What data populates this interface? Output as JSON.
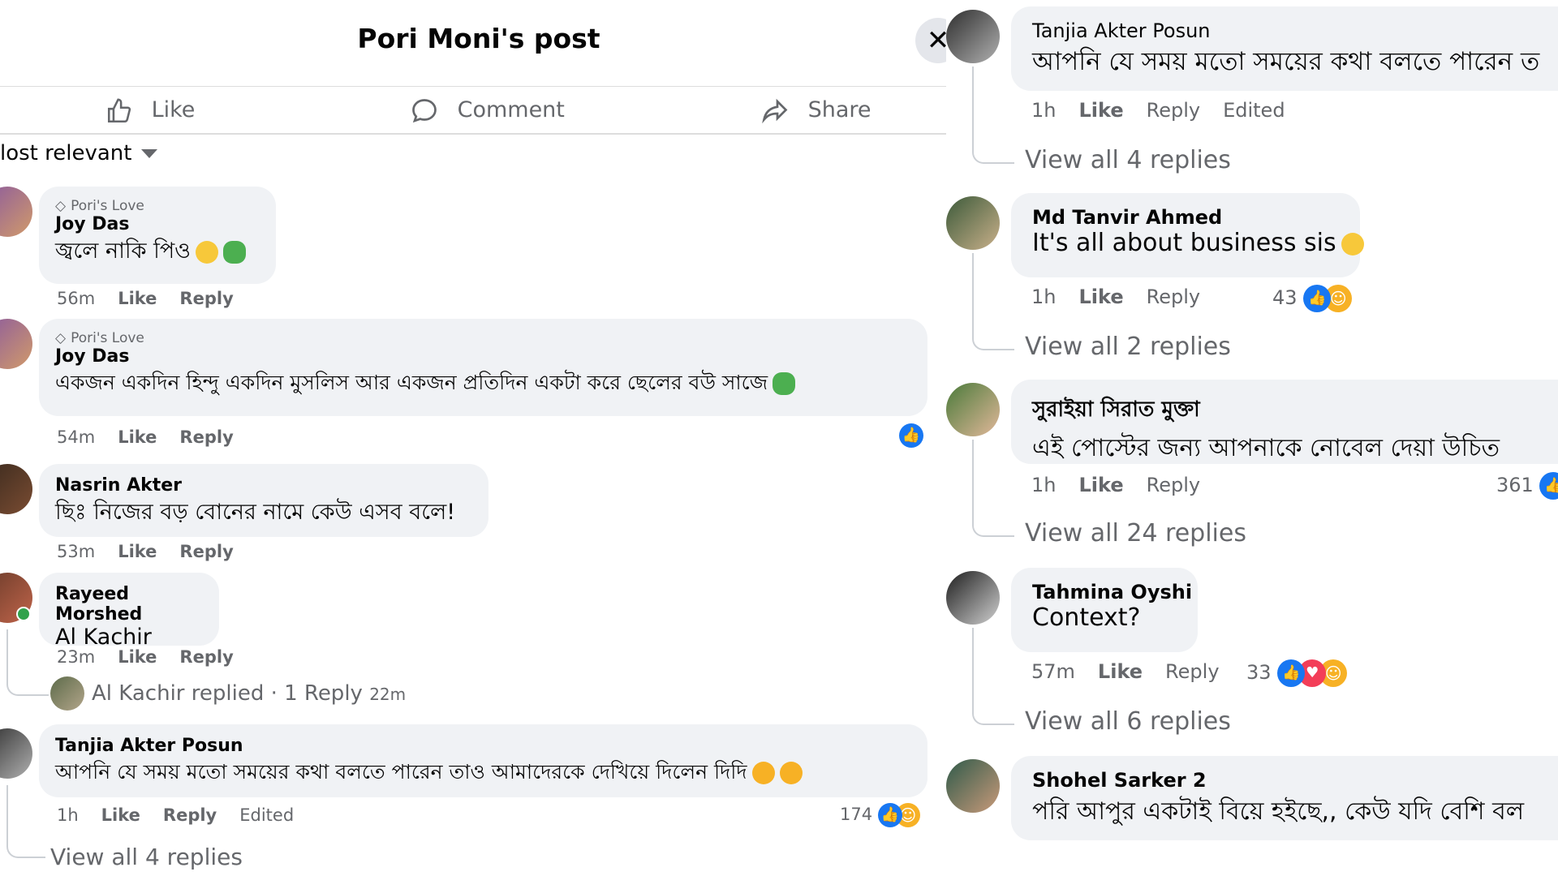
{
  "header": {
    "title": "Pori Moni's post",
    "close_glyph": "✕"
  },
  "actions": {
    "like": "Like",
    "comment": "Comment",
    "share": "Share"
  },
  "sort": {
    "label": "lost relevant"
  },
  "colors": {
    "accent": "#1877f2",
    "bubble": "#f0f2f5",
    "muted": "#65676b"
  },
  "left_comments": [
    {
      "flair": "Pori's Love",
      "name": "Joy Das",
      "text": "জ্বলে নাকি পিও",
      "time": "56m",
      "like": "Like",
      "reply": "Reply"
    },
    {
      "flair": "Pori's Love",
      "name": "Joy Das",
      "text": "একজন একদিন হিন্দু একদিন মুসলিস আর একজন প্রতিদিন একটা করে ছেলের বউ সাজে",
      "time": "54m",
      "like": "Like",
      "reply": "Reply"
    },
    {
      "name": "Nasrin Akter",
      "text": "ছিঃ নিজের বড় বোনের নামে কেউ এসব বলে!",
      "time": "53m",
      "like": "Like",
      "reply": "Reply"
    },
    {
      "name": "Rayeed Morshed",
      "text": "Al Kachir",
      "time": "23m",
      "like": "Like",
      "reply": "Reply",
      "reply_summary": {
        "text": "Al Kachir replied · 1 Reply",
        "time": "22m"
      }
    },
    {
      "name": "Tanjia Akter Posun",
      "text": "আপনি যে সময় মতো সময়ের কথা বলতে পারেন তাও আমাদেরকে দেখিয়ে দিলেন দিদি",
      "time": "1h",
      "like": "Like",
      "reply": "Reply",
      "edited": "Edited",
      "reactions": "174",
      "view_all": "View all 4 replies"
    }
  ],
  "right_comments": [
    {
      "name": "Tanjia Akter Posun",
      "text": "আপনি যে সময় মতো সময়ের কথা বলতে পারেন ত",
      "time": "1h",
      "like": "Like",
      "reply": "Reply",
      "edited": "Edited",
      "view_all": "View all 4 replies"
    },
    {
      "name": "Md Tanvir Ahmed",
      "text": "It's all about business sis",
      "time": "1h",
      "like": "Like",
      "reply": "Reply",
      "reactions": "43",
      "view_all": "View all 2 replies"
    },
    {
      "name": "সুরাইয়া সিরাত মুক্তা",
      "text": "এই পোস্টের জন্য আপনাকে নোবেল দেয়া উচিত",
      "time": "1h",
      "like": "Like",
      "reply": "Reply",
      "reactions": "361",
      "view_all": "View all 24 replies"
    },
    {
      "name": "Tahmina Oyshi",
      "text": "Context?",
      "time": "57m",
      "like": "Like",
      "reply": "Reply",
      "reactions": "33",
      "view_all": "View all 6 replies"
    },
    {
      "name": "Shohel Sarker 2",
      "text": "পরি আপুর একটাই বিয়ে হইছে,, কেউ যদি বেশি বল"
    }
  ]
}
